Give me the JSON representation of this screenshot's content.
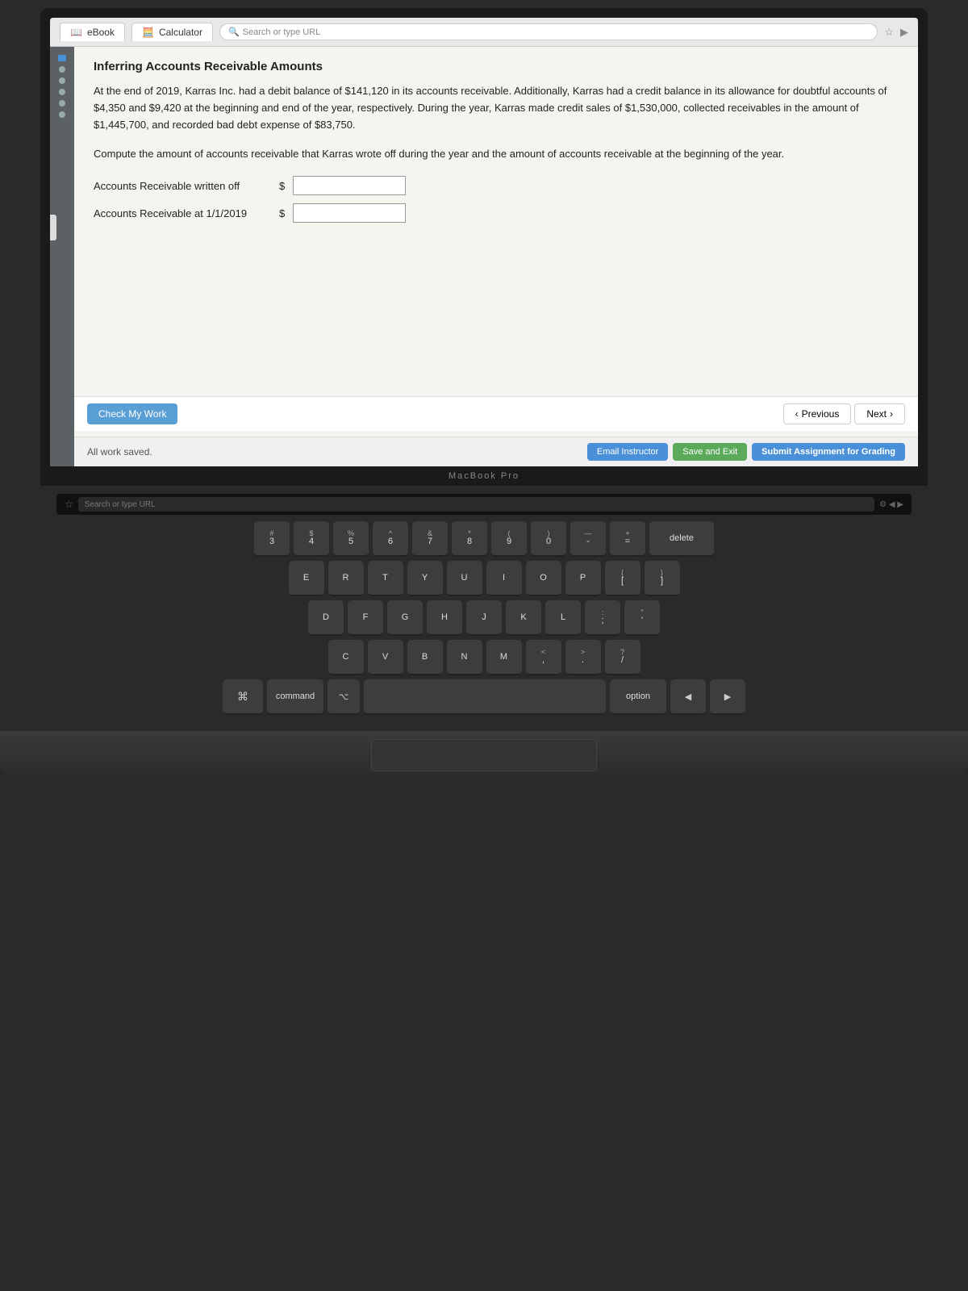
{
  "browser": {
    "tabs": [
      {
        "label": "eBook",
        "icon": "book"
      },
      {
        "label": "Calculator",
        "icon": "calc"
      }
    ],
    "url": "Search or type URL"
  },
  "page": {
    "title": "Inferring Accounts Receivable Amounts",
    "body_paragraph": "At the end of 2019, Karras Inc. had a debit balance of $141,120 in its accounts receivable. Additionally, Karras had a credit balance in its allowance for doubtful accounts of $4,350 and $9,420 at the beginning and end of the year, respectively. During the year, Karras made credit sales of $1,530,000, collected receivables in the amount of $1,445,700, and recorded bad debt expense of $83,750.",
    "problem_text": "Compute the amount of accounts receivable that Karras wrote off during the year and the amount of accounts receivable at the beginning of the year.",
    "form": {
      "fields": [
        {
          "label": "Accounts Receivable written off",
          "prefix": "$",
          "value": ""
        },
        {
          "label": "Accounts Receivable at 1/1/2019",
          "prefix": "$",
          "value": ""
        }
      ]
    },
    "check_work_btn": "Check My Work",
    "prev_btn": "Previous",
    "next_btn": "Next",
    "saved_text": "All work saved.",
    "email_btn": "Email Instructor",
    "save_exit_btn": "Save and Exit",
    "submit_btn": "Submit Assignment for Grading"
  },
  "macbook_label": "MacBook Pro",
  "keyboard": {
    "row1": [
      {
        "top": "#",
        "bottom": "3"
      },
      {
        "top": "$",
        "bottom": "4"
      },
      {
        "top": "%",
        "bottom": "5"
      },
      {
        "top": "^",
        "bottom": "6"
      },
      {
        "top": "&",
        "bottom": "7"
      },
      {
        "top": "*",
        "bottom": "8"
      },
      {
        "top": "(",
        "bottom": "9"
      },
      {
        "top": ")",
        "bottom": "0"
      },
      {
        "top": "—",
        "bottom": "-"
      },
      {
        "top": "+",
        "bottom": "="
      },
      {
        "label": "delete",
        "wide": true
      }
    ],
    "row2": [
      {
        "label": "E"
      },
      {
        "label": "R"
      },
      {
        "label": "T"
      },
      {
        "label": "Y"
      },
      {
        "label": "U"
      },
      {
        "label": "I"
      },
      {
        "label": "O"
      },
      {
        "label": "P"
      },
      {
        "top": "{",
        "bottom": "["
      },
      {
        "top": "}",
        "bottom": "]"
      }
    ],
    "row3": [
      {
        "label": "D"
      },
      {
        "label": "F"
      },
      {
        "label": "G"
      },
      {
        "label": "H"
      },
      {
        "label": "J"
      },
      {
        "label": "K"
      },
      {
        "label": "L"
      },
      {
        "top": ":",
        "bottom": ";"
      },
      {
        "top": "\"",
        "bottom": "'"
      }
    ],
    "row4": [
      {
        "label": "C"
      },
      {
        "label": "V"
      },
      {
        "label": "B"
      },
      {
        "label": "N"
      },
      {
        "label": "M"
      },
      {
        "top": "<",
        "bottom": ","
      },
      {
        "top": ">",
        "bottom": "."
      },
      {
        "top": "?",
        "bottom": "/"
      }
    ],
    "bottom": {
      "command": "command",
      "option": "option"
    }
  }
}
